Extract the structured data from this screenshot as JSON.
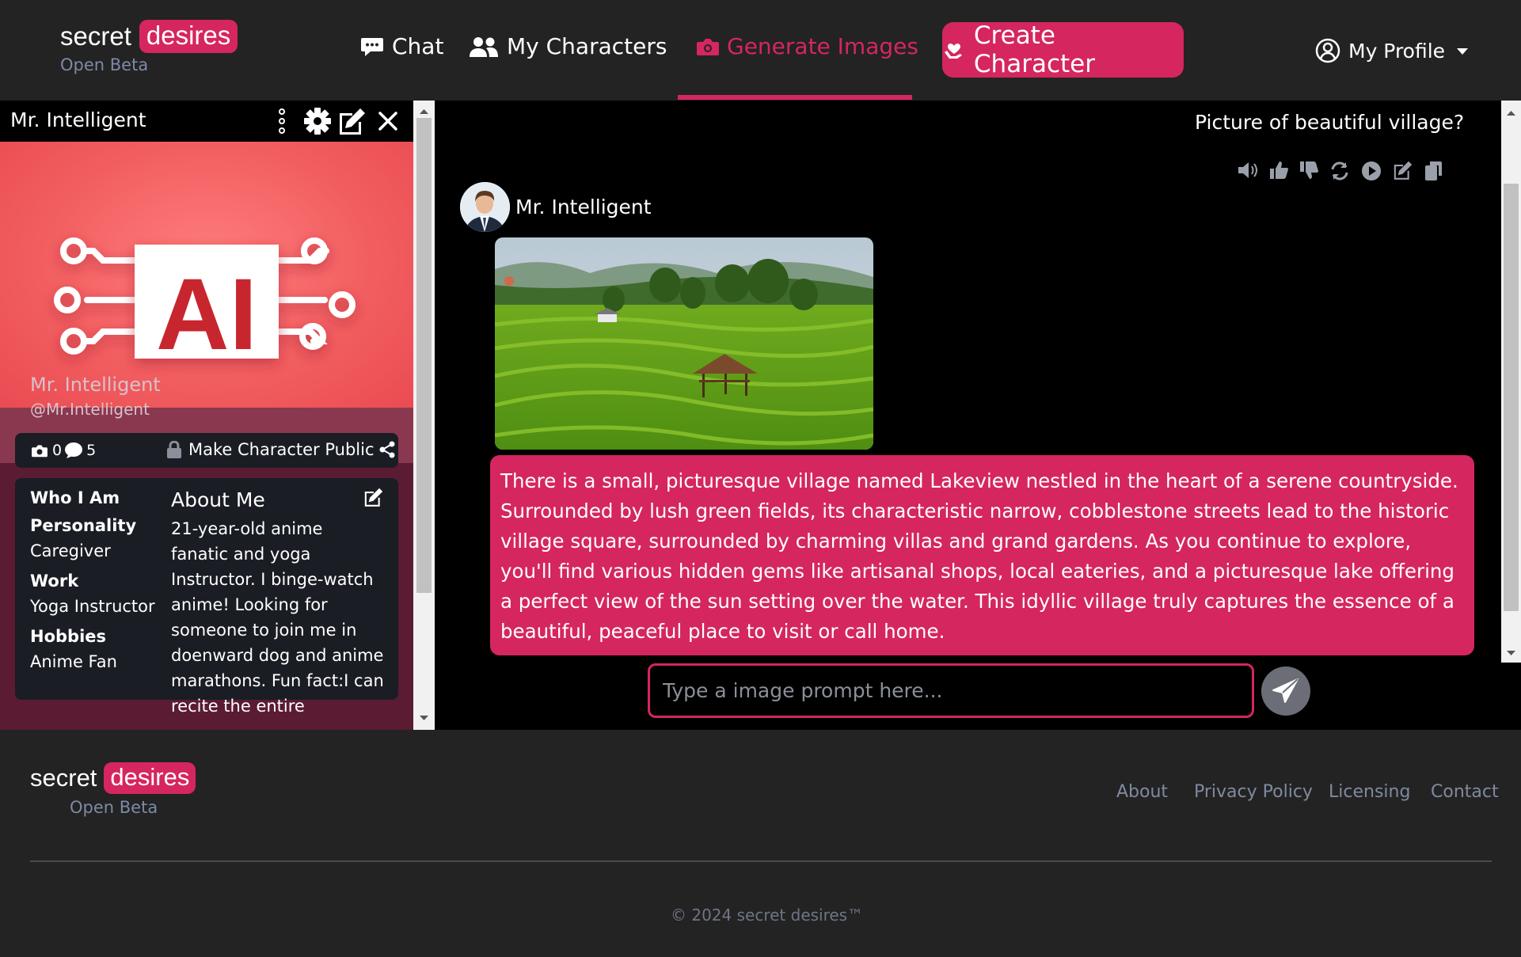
{
  "brand": {
    "secret": "secret",
    "desires": "desires",
    "tagline": "Open Beta"
  },
  "nav": {
    "chat": "Chat",
    "my_characters": "My Characters",
    "generate_images": "Generate Images",
    "create_character": "Create Character",
    "my_profile": "My Profile"
  },
  "sidebar": {
    "title": "Mr. Intelligent",
    "hero_text": "AI",
    "character_name": "Mr. Intelligent",
    "handle": "@Mr.Intelligent",
    "photo_count": "0",
    "chat_count": "5",
    "make_public": "Make Character Public",
    "who_i_am": "Who I Am",
    "personality_label": "Personality",
    "personality_value": "Caregiver",
    "work_label": "Work",
    "work_value": "Yoga Instructor",
    "hobbies_label": "Hobbies",
    "hobbies_value": "Anime Fan",
    "about_title": "About Me",
    "about_text": "21-year-old anime fanatic and yoga Instructor. I binge-watch anime! Looking for someone to join me in doenward dog and anime marathons. Fun fact:I can recite the entire"
  },
  "chat": {
    "user_message": "Picture of beautiful village?",
    "bot_name": "Mr. Intelligent",
    "bot_message": "There is a small, picturesque village named Lakeview nestled in the heart of a serene countryside. Surrounded by lush green fields, its characteristic narrow, cobblestone streets lead to the historic village square, surrounded by charming villas and grand gardens. As you continue to explore, you'll find various hidden gems like artisanal shops, local eateries, and a picturesque lake offering a perfect view of the sun setting over the water. This idyllic village truly captures the essence of a beautiful, peaceful place to visit or call home.",
    "input_placeholder": "Type a image prompt here..."
  },
  "footer": {
    "about": "About",
    "privacy": "Privacy Policy",
    "licensing": "Licensing",
    "contact": "Contact",
    "copyright": "© 2024 secret desires™"
  },
  "colors": {
    "accent": "#d5265f",
    "background": "#232323",
    "panel": "#000000",
    "muted_link": "#7f8aa0"
  },
  "icons": [
    "chat-icon",
    "users-icon",
    "camera-icon",
    "heart-hand-icon",
    "user-circle-icon",
    "chevron-down-icon",
    "kebab-icon",
    "gear-icon",
    "edit-icon",
    "close-icon",
    "lock-icon",
    "share-icon",
    "speaker-icon",
    "thumbs-up-icon",
    "thumbs-down-icon",
    "refresh-icon",
    "play-icon",
    "copy-icon",
    "send-icon"
  ]
}
